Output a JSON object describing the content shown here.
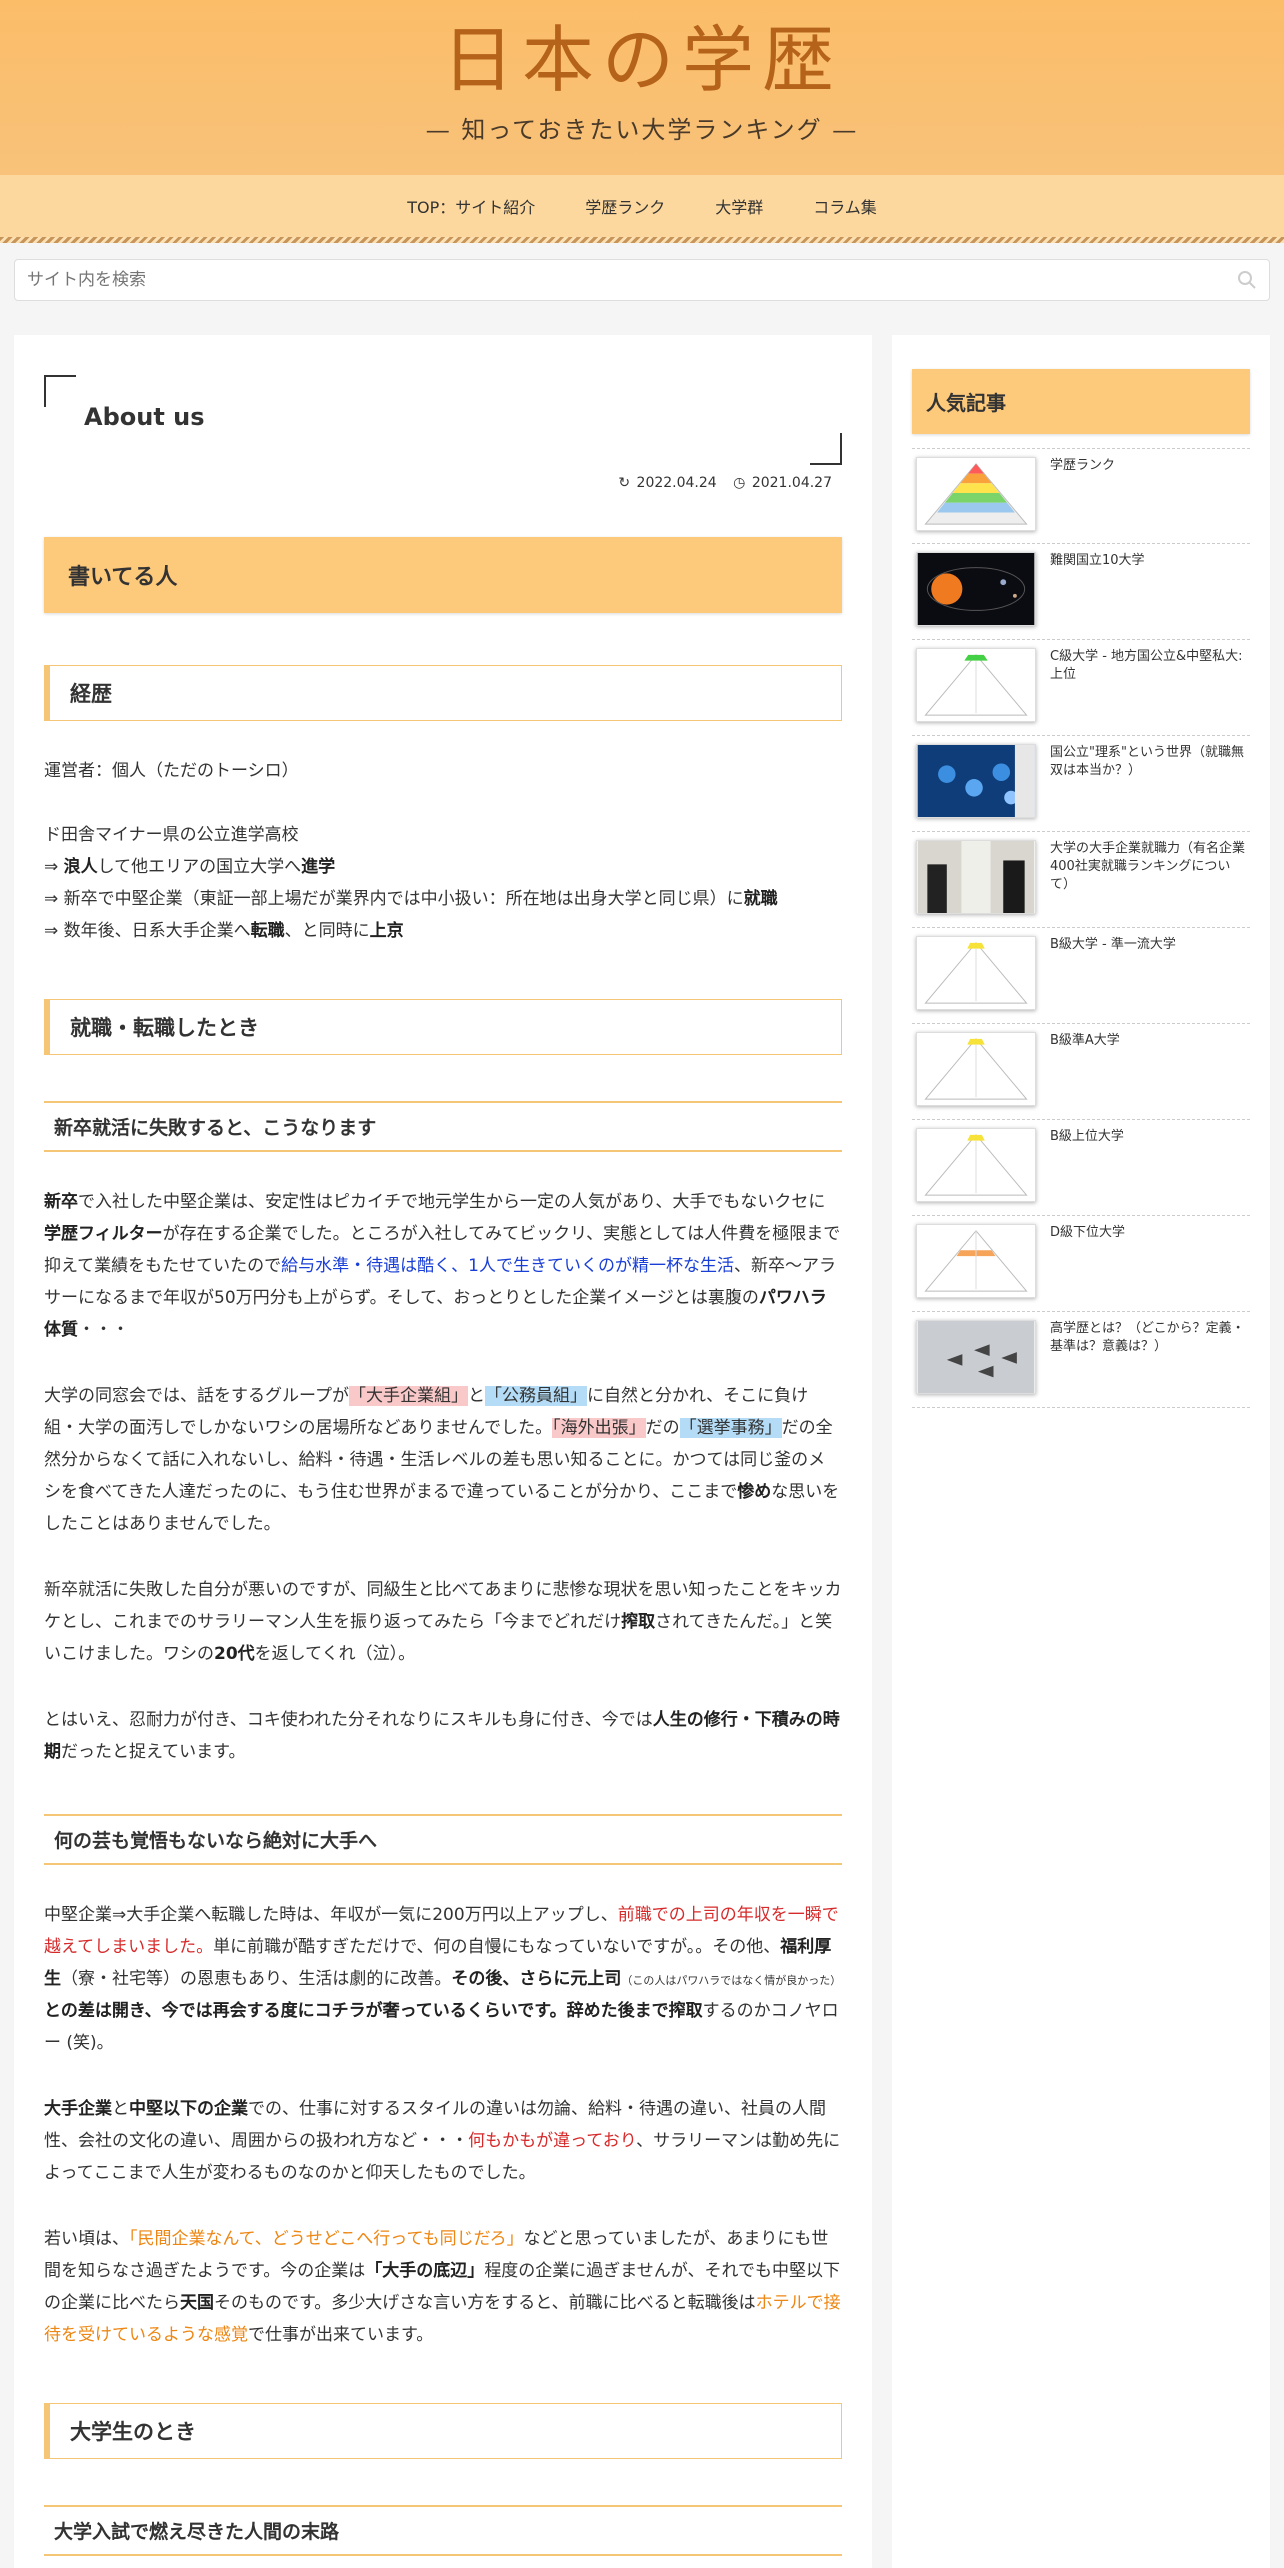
{
  "site": {
    "title": "日本の学歴",
    "subtitle": "— 知っておきたい大学ランキング —"
  },
  "nav": [
    "TOP：サイト紹介",
    "学歴ランク",
    "大学群",
    "コラム集"
  ],
  "search": {
    "placeholder": "サイト内を検索"
  },
  "article": {
    "title": "About us",
    "updated": "2022.04.24",
    "published": "2021.04.27",
    "h2_writer": "書いてる人",
    "h3_career": "経歴",
    "career_lines": [
      "運営者：個人（ただのトーシロ）",
      "ド田舎マイナー県の公立進学高校",
      "⇒ 浪人して他エリアの国立大学へ進学",
      "⇒ 新卒で中堅企業（東証一部上場だが業界内では中小扱い：所在地は出身大学と同じ県）に就職",
      "⇒ 数年後、日系大手企業へ転職、と同時に上京"
    ],
    "h3_job": "就職・転職したとき",
    "h4_fail": "新卒就活に失敗すると、こうなります",
    "h4_effort": "何の芸も覚悟もないなら絶対に大手へ",
    "h2_student": "大学生のとき",
    "h4_exam": "大学入試で燃え尽きた人間の末路"
  },
  "sidebar": {
    "widget_title": "人気記事",
    "items": [
      {
        "label": "学歴ランク",
        "thumb": "pyramid-color"
      },
      {
        "label": "難関国立10大学",
        "thumb": "solar-system"
      },
      {
        "label": "C級大学 - 地方国公立&中堅私大:上位",
        "thumb": "pyramid-green"
      },
      {
        "label": "国公立\"理系\"という世界（就職無双は本当か？）",
        "thumb": "network-blue"
      },
      {
        "label": "大学の大手企業就職力（有名企業400社実就職ランキングについて）",
        "thumb": "office-people"
      },
      {
        "label": "B級大学 - 準一流大学",
        "thumb": "pyramid-yellow"
      },
      {
        "label": "B級準A大学",
        "thumb": "pyramid-yellow"
      },
      {
        "label": "B級上位大学",
        "thumb": "pyramid-yellow"
      },
      {
        "label": "D級下位大学",
        "thumb": "pyramid-orange"
      },
      {
        "label": "高学歴とは？（どこから？定義・基準は？意義は？）",
        "thumb": "jets"
      }
    ]
  },
  "colors": {
    "header": "#fbbd68",
    "accent": "#fdc97b",
    "title": "#b5621a"
  }
}
